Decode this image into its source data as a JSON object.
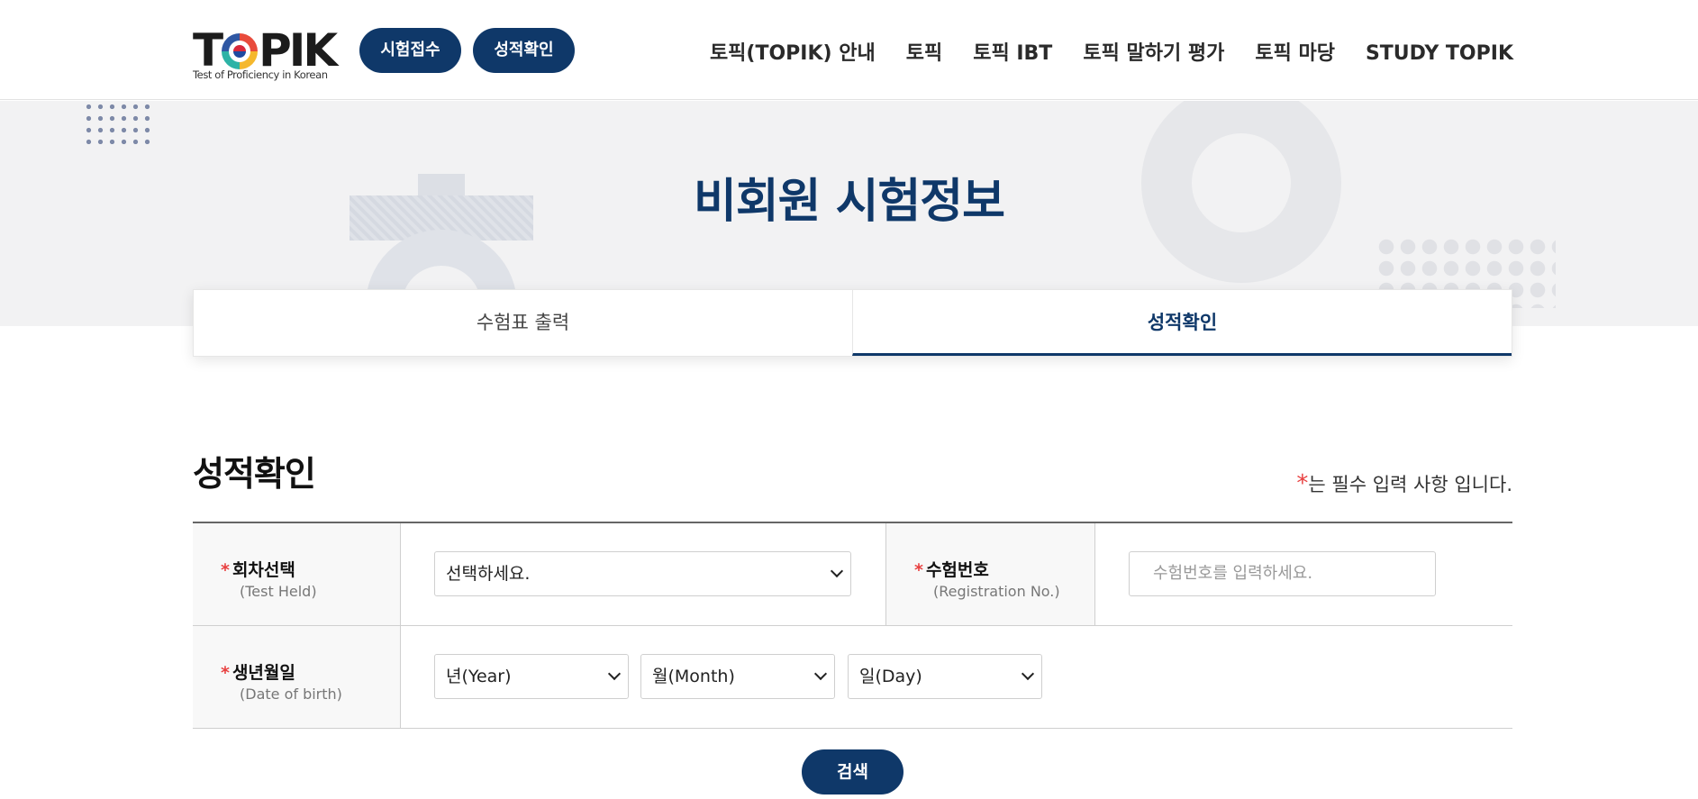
{
  "header": {
    "logo_text_pre": "T",
    "logo_text_post": "PIK",
    "logo_sub": "Test of Proficiency in Korean",
    "pill_buttons": [
      "시험접수",
      "성적확인"
    ],
    "nav": [
      "토픽(TOPIK) 안내",
      "토픽",
      "토픽 IBT",
      "토픽 말하기 평가",
      "토픽 마당",
      "STUDY TOPIK"
    ]
  },
  "banner": {
    "title": "비회원 시험정보"
  },
  "tabs": [
    {
      "label": "수험표 출력",
      "active": false
    },
    {
      "label": "성적확인",
      "active": true
    }
  ],
  "section": {
    "title": "성적확인",
    "required_star": "*",
    "required_note": "는 필수 입력 사항 입니다."
  },
  "form": {
    "test_held": {
      "label": "회차선택",
      "label_en": "(Test Held)",
      "value": "선택하세요."
    },
    "reg_no": {
      "label": "수험번호",
      "label_en": "(Registration No.)",
      "placeholder": "수험번호를 입력하세요."
    },
    "dob": {
      "label": "생년월일",
      "label_en": "(Date of birth)",
      "year": "년(Year)",
      "month": "월(Month)",
      "day": "일(Day)"
    },
    "required_mark": "*"
  },
  "search_button": "검색",
  "colors": {
    "primary": "#0f3869",
    "required": "#e84040",
    "highlight": "#c5dcef"
  }
}
